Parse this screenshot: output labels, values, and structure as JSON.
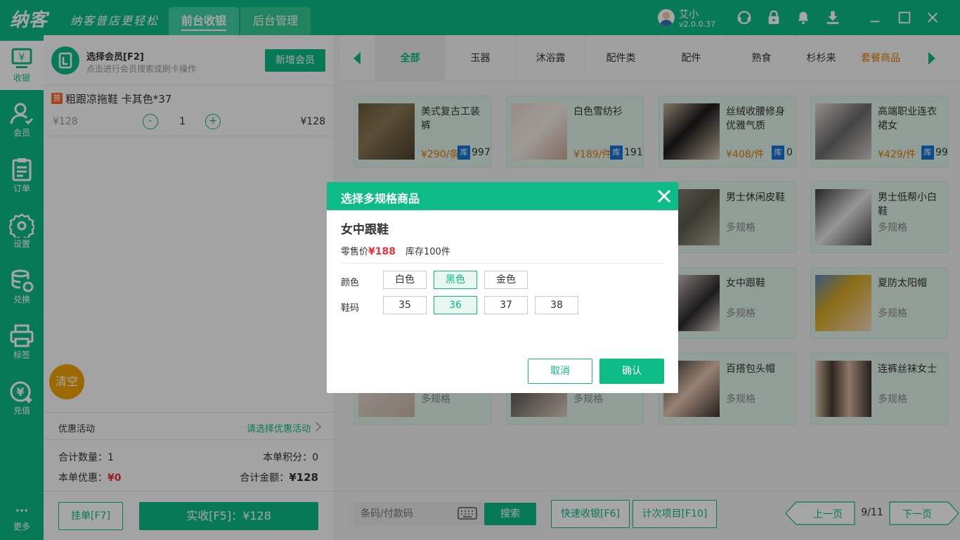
{
  "app": {
    "logo": "纳客",
    "slogan": "纳客普店更轻松"
  },
  "top_tabs": [
    {
      "label": "前台收银"
    },
    {
      "label": "后台管理"
    }
  ],
  "user": {
    "name": "艾小",
    "version": "v2.0.0.37"
  },
  "top_icons": [
    "headset-icon",
    "lock-icon",
    "bell-icon",
    "download-icon",
    "minimize-icon",
    "maximize-icon",
    "close-icon"
  ],
  "sidebar": {
    "items": [
      {
        "label": "收银",
        "icon": "cashier-icon"
      },
      {
        "label": "会员",
        "icon": "member-icon"
      },
      {
        "label": "订单",
        "icon": "order-icon"
      },
      {
        "label": "设置",
        "icon": "settings-icon"
      },
      {
        "label": "兑换",
        "icon": "exchange-icon"
      },
      {
        "label": "标签",
        "icon": "printer-icon"
      },
      {
        "label": "充值",
        "icon": "recharge-icon"
      },
      {
        "label": "更多",
        "icon": "more-icon"
      }
    ]
  },
  "member": {
    "title": "选择会员[F2]",
    "hint": "点击进行会员搜索或刷卡操作",
    "new_button": "新增会员"
  },
  "cart": {
    "items": [
      {
        "badge": "普",
        "name": "粗跟凉拖鞋 卡其色*37",
        "unit_price": "¥128",
        "qty": "1",
        "minus": "-",
        "plus": "+",
        "subtotal": "¥128"
      }
    ]
  },
  "clear_button": "清空",
  "promo": {
    "label": "优惠活动",
    "select": "请选择优惠活动"
  },
  "totals": {
    "qty_label": "合计数量：",
    "qty_value": "1",
    "points_label": "本单积分：",
    "points_value": "0",
    "discount_label": "本单优惠：",
    "discount_value": "¥0",
    "amount_label": "合计金额：",
    "amount_value": "¥128"
  },
  "hold_button": "挂单[F7]",
  "pay_button": "实收[F5]：¥128",
  "categories": [
    "全部",
    "玉器",
    "沐浴露",
    "配件类",
    "配件",
    "熟食",
    "杉杉来",
    "套餐商品"
  ],
  "products": [
    {
      "name": "美式复古工装裤",
      "price": "¥290/条",
      "stock_badge": "库",
      "stock": "997"
    },
    {
      "name": "白色雪纺衫",
      "price": "¥189/件",
      "stock_badge": "库",
      "stock": "191"
    },
    {
      "name": "丝绒收腰修身优雅气质",
      "price": "¥408/件",
      "stock_badge": "库",
      "stock": "0"
    },
    {
      "name": "高端职业连衣裙女",
      "price": "¥429/件",
      "stock_badge": "库",
      "stock": "99"
    },
    {
      "name": "男士休闲皮鞋",
      "spec": "多规格"
    },
    {
      "name": "男士低帮小白鞋",
      "spec": "多规格"
    },
    {
      "name": "女中跟鞋",
      "spec": "多规格"
    },
    {
      "name": "夏防太阳帽",
      "spec": "多规格"
    },
    {
      "name": "",
      "spec": "多规格"
    },
    {
      "name": "",
      "spec": "多规格"
    },
    {
      "name": "百搭包头帽",
      "spec": "多规格"
    },
    {
      "name": "连裤丝袜女士",
      "spec": "多规格"
    }
  ],
  "search": {
    "placeholder": "条码/付款码",
    "button": "搜索"
  },
  "quick_button": "快速收银[F6]",
  "count_button": "计次项目[F10]",
  "pager": {
    "prev": "上一页",
    "page": "9/11",
    "next": "下一页"
  },
  "dialog": {
    "title": "选择多规格商品",
    "product_name": "女中跟鞋",
    "price_label": "零售价",
    "price": "¥188",
    "stock": "库存100件",
    "color_label": "颜色",
    "colors": [
      "白色",
      "黑色",
      "金色"
    ],
    "selected_color": "黑色",
    "size_label": "鞋码",
    "sizes": [
      "35",
      "36",
      "37",
      "38"
    ],
    "selected_size": "36",
    "cancel": "取消",
    "confirm": "确认"
  },
  "colors": {
    "primary": "#0cbb86",
    "price_red": "#e8333a",
    "orange": "#e07a00",
    "stock_blue": "#1673d8"
  }
}
